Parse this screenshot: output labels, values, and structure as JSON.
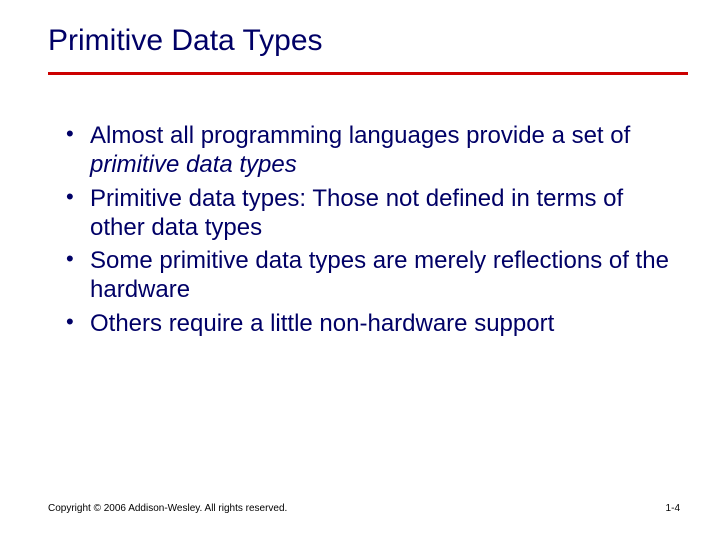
{
  "title": "Primitive Data Types",
  "bullets": [
    {
      "pre": "Almost all programming languages provide a set of ",
      "em": "primitive data types",
      "post": ""
    },
    {
      "pre": "Primitive data types: Those not defined in terms of other data types",
      "em": "",
      "post": ""
    },
    {
      "pre": "Some primitive data types are merely reflections of the hardware",
      "em": "",
      "post": ""
    },
    {
      "pre": "Others require a little non-hardware support",
      "em": "",
      "post": ""
    }
  ],
  "footer": {
    "copyright": "Copyright © 2006 Addison-Wesley. All rights reserved.",
    "page": "1-4"
  }
}
